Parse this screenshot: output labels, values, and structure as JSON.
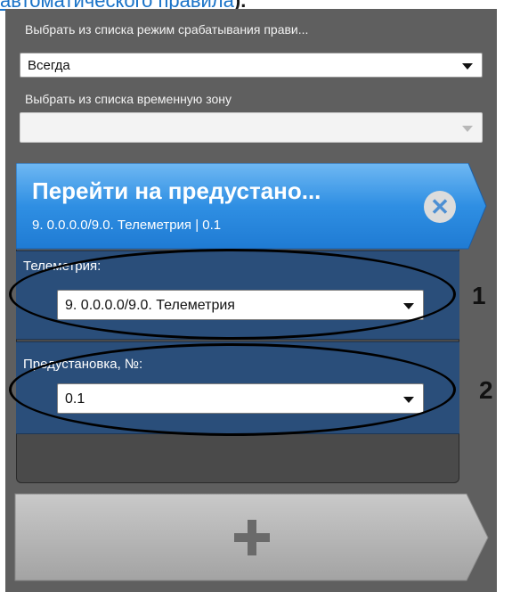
{
  "top_link": {
    "text": "автоматического правила",
    "tail": ")."
  },
  "trigger_mode": {
    "label": "Выбрать из списка режим срабатывания прави...",
    "value": "Всегда"
  },
  "time_zone": {
    "label": "Выбрать из списка временную зону",
    "value": ""
  },
  "action_card": {
    "title": "Перейти на предустано...",
    "subtitle": "9. 0.0.0.0/9.0. Телеметрия | 0.1",
    "close_icon": "close-icon",
    "header_color": "#2f8fe3"
  },
  "fields": [
    {
      "label": "Телеметрия:",
      "value": "9. 0.0.0.0/9.0. Телеметрия",
      "callout": "1"
    },
    {
      "label": "Предустановка, №:",
      "value": "0.1",
      "callout": "2"
    }
  ],
  "add_button": {
    "icon": "plus-icon"
  },
  "colors": {
    "panel_bg": "#5f5f5f",
    "field_bg": "#2a4e7a",
    "header_blue": "#2f8fe3",
    "link_blue": "#1a73c8"
  }
}
